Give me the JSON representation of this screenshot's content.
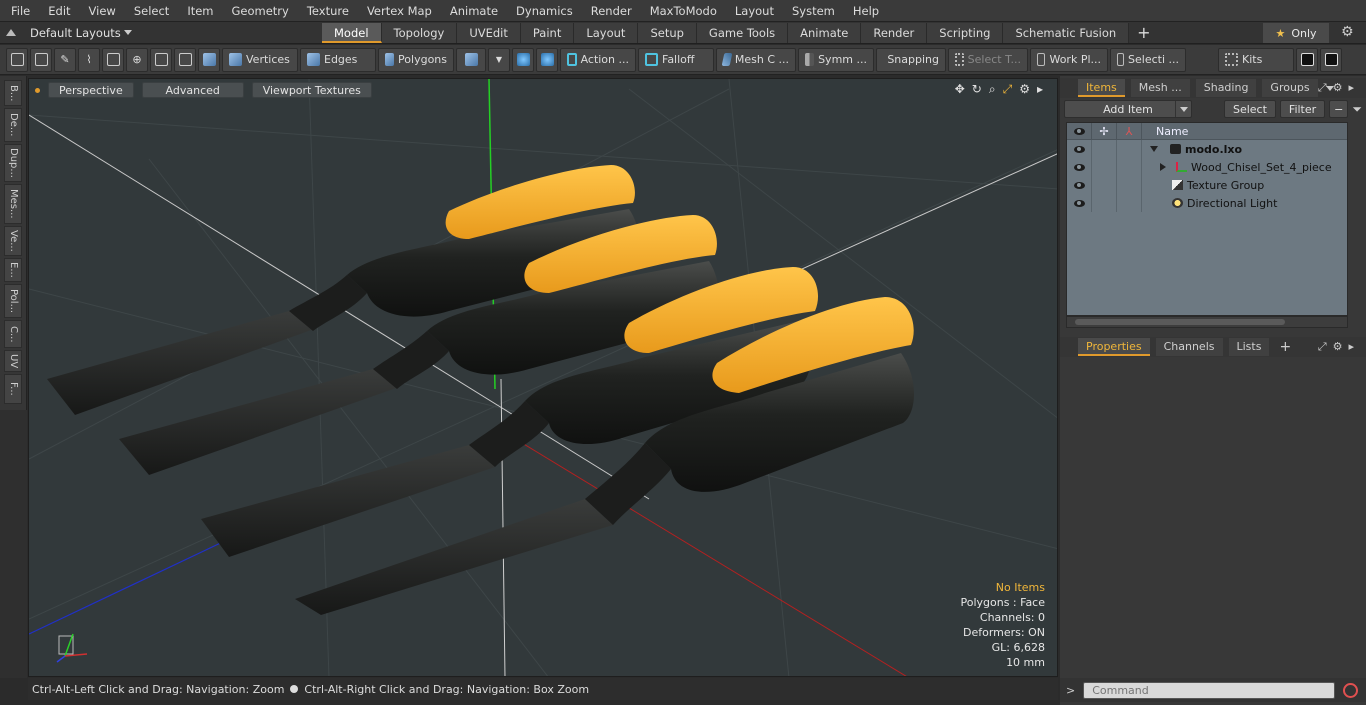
{
  "menu": [
    "File",
    "Edit",
    "View",
    "Select",
    "Item",
    "Geometry",
    "Texture",
    "Vertex Map",
    "Animate",
    "Dynamics",
    "Render",
    "MaxToModo",
    "Layout",
    "System",
    "Help"
  ],
  "layouts": {
    "label": "Default Layouts"
  },
  "tabs": [
    {
      "label": "Model",
      "active": true
    },
    {
      "label": "Topology"
    },
    {
      "label": "UVEdit"
    },
    {
      "label": "Paint"
    },
    {
      "label": "Layout"
    },
    {
      "label": "Setup"
    },
    {
      "label": "Game Tools"
    },
    {
      "label": "Animate"
    },
    {
      "label": "Render"
    },
    {
      "label": "Scripting"
    },
    {
      "label": "Schematic Fusion"
    }
  ],
  "tabbar_right": {
    "only_label": "Only"
  },
  "toolbar": {
    "vertices": "Vertices",
    "edges": "Edges",
    "polygons": "Polygons",
    "action": "Action ...",
    "falloff": "Falloff",
    "mesh": "Mesh C ...",
    "symm": "Symm ...",
    "snapping": "Snapping",
    "select_t": "Select T...",
    "work_pl": "Work Pl...",
    "selecti": "Selecti ...",
    "kits": "Kits"
  },
  "left_tabs": [
    "B...",
    "De...",
    "Dup...",
    "Mes...",
    "Ve...",
    "E...",
    "Pol...",
    "C...",
    "UV",
    "F..."
  ],
  "viewport": {
    "view_mode": "Perspective",
    "shading": "Advanced",
    "texture_mode": "Viewport Textures",
    "info": {
      "selection": "No Items",
      "polygons": "Polygons : Face",
      "channels": "Channels: 0",
      "deformers": "Deformers: ON",
      "gl": "GL: 6,628",
      "grid": "10 mm"
    }
  },
  "statusbar": {
    "hint_left": "Ctrl-Alt-Left Click and Drag: Navigation: Zoom",
    "hint_right": "Ctrl-Alt-Right Click and Drag: Navigation: Box Zoom"
  },
  "items_panel": {
    "tabs": [
      {
        "label": "Items",
        "active": true
      },
      {
        "label": "Mesh ..."
      },
      {
        "label": "Shading"
      },
      {
        "label": "Groups"
      }
    ],
    "add_item": "Add Item",
    "select": "Select",
    "filter": "Filter",
    "column_name": "Name",
    "tree": [
      {
        "label": "modo.lxo",
        "depth": 0,
        "bold": true,
        "icon": "scene-icon"
      },
      {
        "label": "Wood_Chisel_Set_4_piece",
        "depth": 1,
        "icon": "mesh-icon"
      },
      {
        "label": "Texture Group",
        "depth": 1,
        "icon": "texture-icon"
      },
      {
        "label": "Directional Light",
        "depth": 1,
        "icon": "light-icon"
      }
    ]
  },
  "properties_panel": {
    "tabs": [
      {
        "label": "Properties",
        "active": true
      },
      {
        "label": "Channels"
      },
      {
        "label": "Lists"
      }
    ]
  },
  "command": {
    "placeholder": "Command",
    "prompt": ">"
  },
  "colors": {
    "accent": "#e09a2c",
    "handle_yellow": "#f3ae2d",
    "handle_black": "#1e1f1e",
    "viewport_bg": "#32393b"
  }
}
